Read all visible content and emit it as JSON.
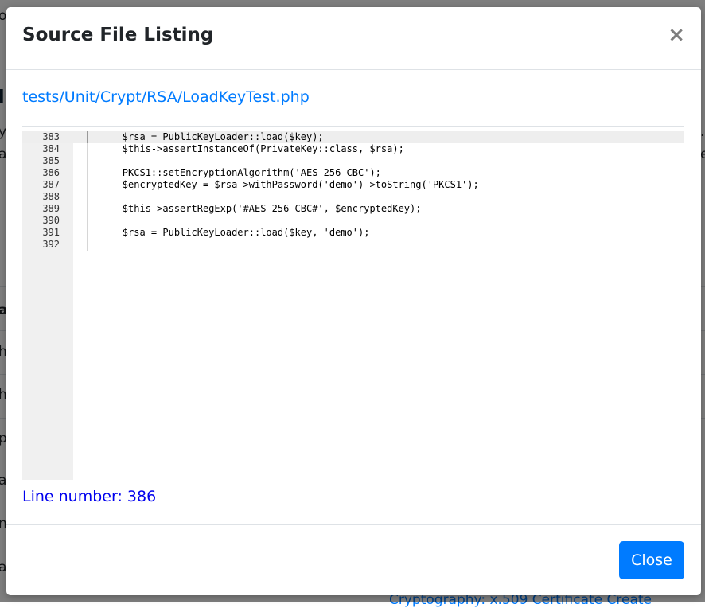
{
  "background": {
    "fragments": [
      {
        "text": "o"
      },
      {
        "text": "l"
      },
      {
        "text": "y"
      },
      {
        "text": "a"
      },
      {
        "text": "a"
      },
      {
        "text": "h"
      },
      {
        "text": "h"
      },
      {
        "text": "p"
      },
      {
        "text": "a"
      },
      {
        "text": "n"
      },
      {
        "text": "a"
      },
      {
        "text": "."
      },
      {
        "text": "e"
      }
    ],
    "bottom_link": "Cryptography: x.509 Certificate Create"
  },
  "modal": {
    "title": "Source File Listing",
    "close_icon": "×",
    "file_path": "tests/Unit/Crypt/RSA/LoadKeyTest.php",
    "code_lines": [
      {
        "num": "383",
        "text": "        $rsa = PublicKeyLoader::load($key);",
        "active": true
      },
      {
        "num": "384",
        "text": "        $this->assertInstanceOf(PrivateKey::class, $rsa);",
        "active": false
      },
      {
        "num": "385",
        "text": "",
        "active": false
      },
      {
        "num": "386",
        "text": "        PKCS1::setEncryptionAlgorithm('AES-256-CBC');",
        "active": false
      },
      {
        "num": "387",
        "text": "        $encryptedKey = $rsa->withPassword('demo')->toString('PKCS1');",
        "active": false
      },
      {
        "num": "388",
        "text": "",
        "active": false
      },
      {
        "num": "389",
        "text": "        $this->assertRegExp('#AES-256-CBC#', $encryptedKey);",
        "active": false
      },
      {
        "num": "390",
        "text": "",
        "active": false
      },
      {
        "num": "391",
        "text": "        $rsa = PublicKeyLoader::load($key, 'demo');",
        "active": false
      },
      {
        "num": "392",
        "text": "",
        "active": false
      }
    ],
    "line_number_text": "Line number: 386",
    "close_button_label": "Close"
  },
  "colors": {
    "link": "#007bff",
    "line_number": "#0000ee",
    "button_bg": "#007bff",
    "gutter_bg": "#f0f0f0"
  }
}
